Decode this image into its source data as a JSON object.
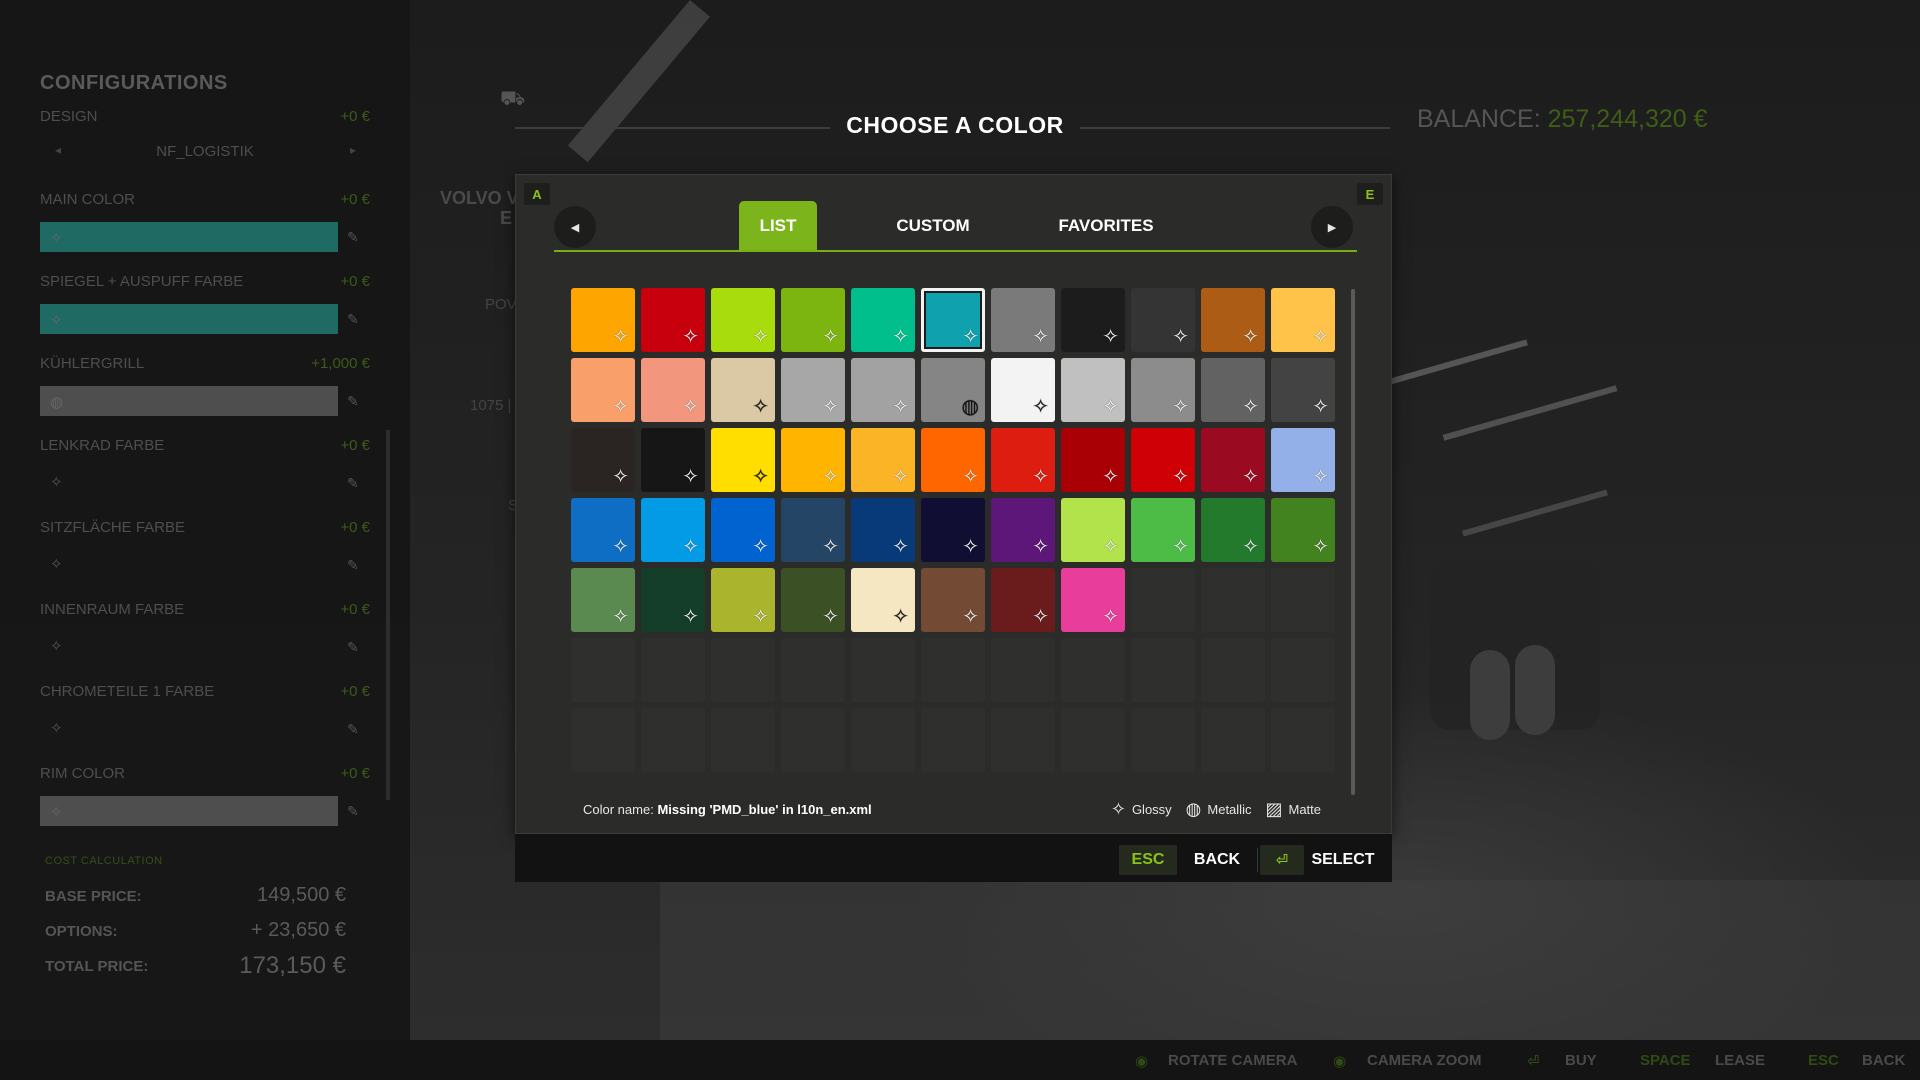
{
  "left_panel": {
    "title": "CONFIGURATIONS",
    "design": {
      "label": "DESIGN",
      "price": "+0 €",
      "value": "NF_LOGISTIK"
    },
    "main_color": {
      "label": "MAIN COLOR",
      "price": "+0 €",
      "swatch": "#1f6a63"
    },
    "spiegel": {
      "label": "SPIEGEL + AUSPUFF FARBE",
      "price": "+0 €",
      "swatch": "#1f6a63"
    },
    "kuehlergrill": {
      "label": "KÜHLERGRILL",
      "price": "+1,000 €",
      "swatch": "#5a5a5a"
    },
    "lenkrad": {
      "label": "LENKRAD FARBE",
      "price": "+0 €"
    },
    "sitzflaeche": {
      "label": "SITZFLÄCHE FARBE",
      "price": "+0 €"
    },
    "innenraum": {
      "label": "INNENRAUM FARBE",
      "price": "+0 €"
    },
    "chrometeile": {
      "label": "CHROMETEILE 1 FARBE",
      "price": "+0 €"
    },
    "rim_color": {
      "label": "RIM COLOR",
      "price": "+0 €",
      "swatch": "#5a5a5a"
    },
    "cost": {
      "title": "COST CALCULATION",
      "base_label": "BASE PRICE:",
      "base_value": "149,500 €",
      "options_label": "OPTIONS:",
      "options_value": "+ 23,650 €",
      "total_label": "TOTAL PRICE:",
      "total_value": "173,150 €"
    }
  },
  "header": {
    "title": "CHOOSE A COLOR",
    "balance_label": "BALANCE:",
    "balance_value": "257,244,320 €"
  },
  "background_text": {
    "vehicle_line1": "VOLVO V",
    "vehicle_line2": "E",
    "pow": "POV",
    "num": "1075 |",
    "s": "S"
  },
  "dialog": {
    "key_prev": "A",
    "key_next": "E",
    "tabs": [
      {
        "label": "LIST",
        "active": true
      },
      {
        "label": "CUSTOM",
        "active": false
      },
      {
        "label": "FAVORITES",
        "active": false
      }
    ],
    "colors": [
      [
        "#ffa500",
        "#c8000d",
        "#a8dc0c",
        "#7cb50f",
        "#00bf8c",
        "#0fa1ad",
        "#7a7a7a",
        "#1c1c1c",
        "#343434",
        "#ac5c14",
        "#ffc34a"
      ],
      [
        "#f9a06a",
        "#f2967e",
        "#dbc8a4",
        "#a7a7a7",
        "#a2a2a2",
        "#858585",
        "#f3f3f3",
        "#c0c0c0",
        "#8c8c8c",
        "#626262",
        "#434343"
      ],
      [
        "#2a2423",
        "#161616",
        "#ffde00",
        "#ffb400",
        "#fbb426",
        "#ff6600",
        "#dc1d0f",
        "#a90006",
        "#cf0006",
        "#9a0a21",
        "#93b0e8"
      ],
      [
        "#0d6ec4",
        "#039be6",
        "#0063cf",
        "#244566",
        "#083a79",
        "#100f33",
        "#5c1779",
        "#b3e34a",
        "#4cbc46",
        "#237a2d",
        "#42821f"
      ],
      [
        "#5a8a50",
        "#143e2a",
        "#aab42c",
        "#3c5026",
        "#f5e7c2",
        "#734b34",
        "#6a1b1b",
        "#e83d9a"
      ]
    ],
    "selected": "0-5",
    "metallic": "1-5",
    "color_name_label": "Color name:",
    "color_name_value": "Missing 'PMD_blue' in l10n_en.xml",
    "legend": {
      "glossy": "Glossy",
      "metallic": "Metallic",
      "matte": "Matte"
    }
  },
  "footer": {
    "esc_key": "ESC",
    "back_label": "BACK",
    "select_key": "⏎",
    "select_label": "SELECT"
  },
  "bottom_bar": {
    "rotate": "ROTATE CAMERA",
    "zoom": "CAMERA ZOOM",
    "buy": "BUY",
    "space_key": "SPACE",
    "lease": "LEASE",
    "esc_key": "ESC",
    "back": "BACK"
  }
}
